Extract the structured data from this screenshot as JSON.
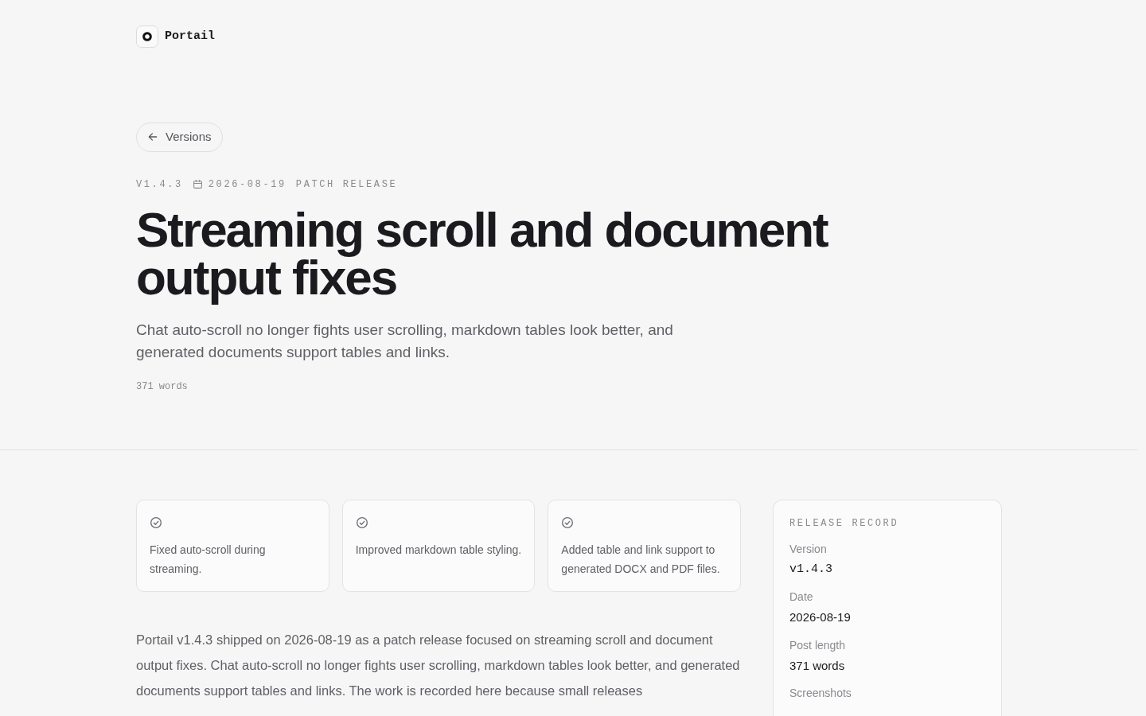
{
  "brand": {
    "name": "Portail"
  },
  "back_link": {
    "label": "Versions"
  },
  "meta": {
    "version": "V1.4.3",
    "date": "2026-08-19",
    "type": "PATCH RELEASE"
  },
  "title": "Streaming scroll and document output fixes",
  "summary": "Chat auto-scroll no longer fights user scrolling, markdown tables look better, and generated documents support tables and links.",
  "word_count": "371 words",
  "highlights": [
    {
      "text": "Fixed auto-scroll during streaming."
    },
    {
      "text": "Improved markdown table styling."
    },
    {
      "text": "Added table and link support to generated DOCX and PDF files."
    }
  ],
  "body": [
    "Portail v1.4.3 shipped on 2026-08-19 as a patch release focused on streaming scroll and document output fixes. Chat auto-scroll no longer fights user scrolling, markdown tables look better, and generated documents support tables and links. The work is recorded here because small releases"
  ],
  "record": {
    "title": "RELEASE RECORD",
    "fields": [
      {
        "label": "Version",
        "value": "v1.4.3",
        "kind": "mono"
      },
      {
        "label": "Date",
        "value": "2026-08-19",
        "kind": "text"
      },
      {
        "label": "Post length",
        "value": "371 words",
        "kind": "text"
      },
      {
        "label": "Screenshots"
      }
    ]
  }
}
